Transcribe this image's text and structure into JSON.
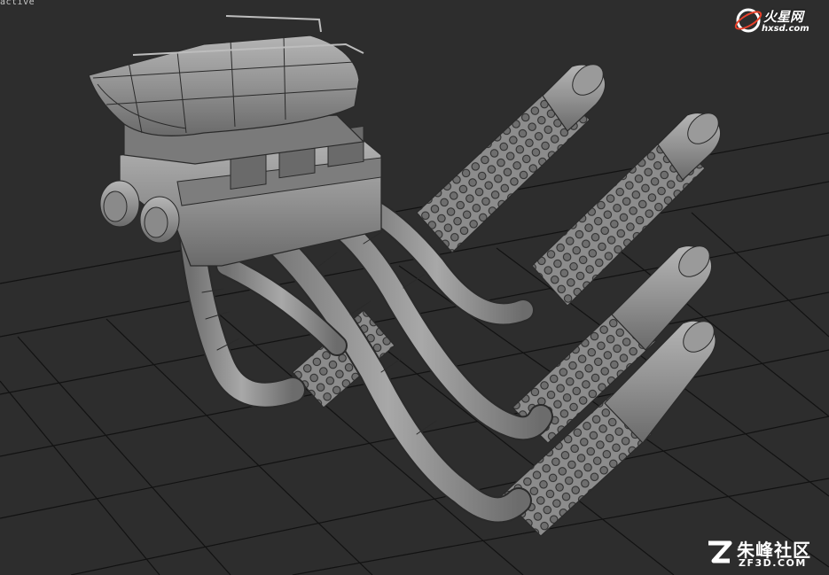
{
  "viewport": {
    "label": "active"
  },
  "watermark_top": {
    "brand": "火星网",
    "url": "hxsd.com",
    "icon": "planet-logo-icon"
  },
  "watermark_bottom": {
    "cn": "朱峰社区",
    "en": "ZF3D.COM",
    "icon": "zf-logo-icon"
  },
  "colors": {
    "background": "#2d2d2d",
    "grid": "#0e0e0e",
    "model_fill": "#9a9a9a",
    "wire": "#2a2a2a"
  }
}
